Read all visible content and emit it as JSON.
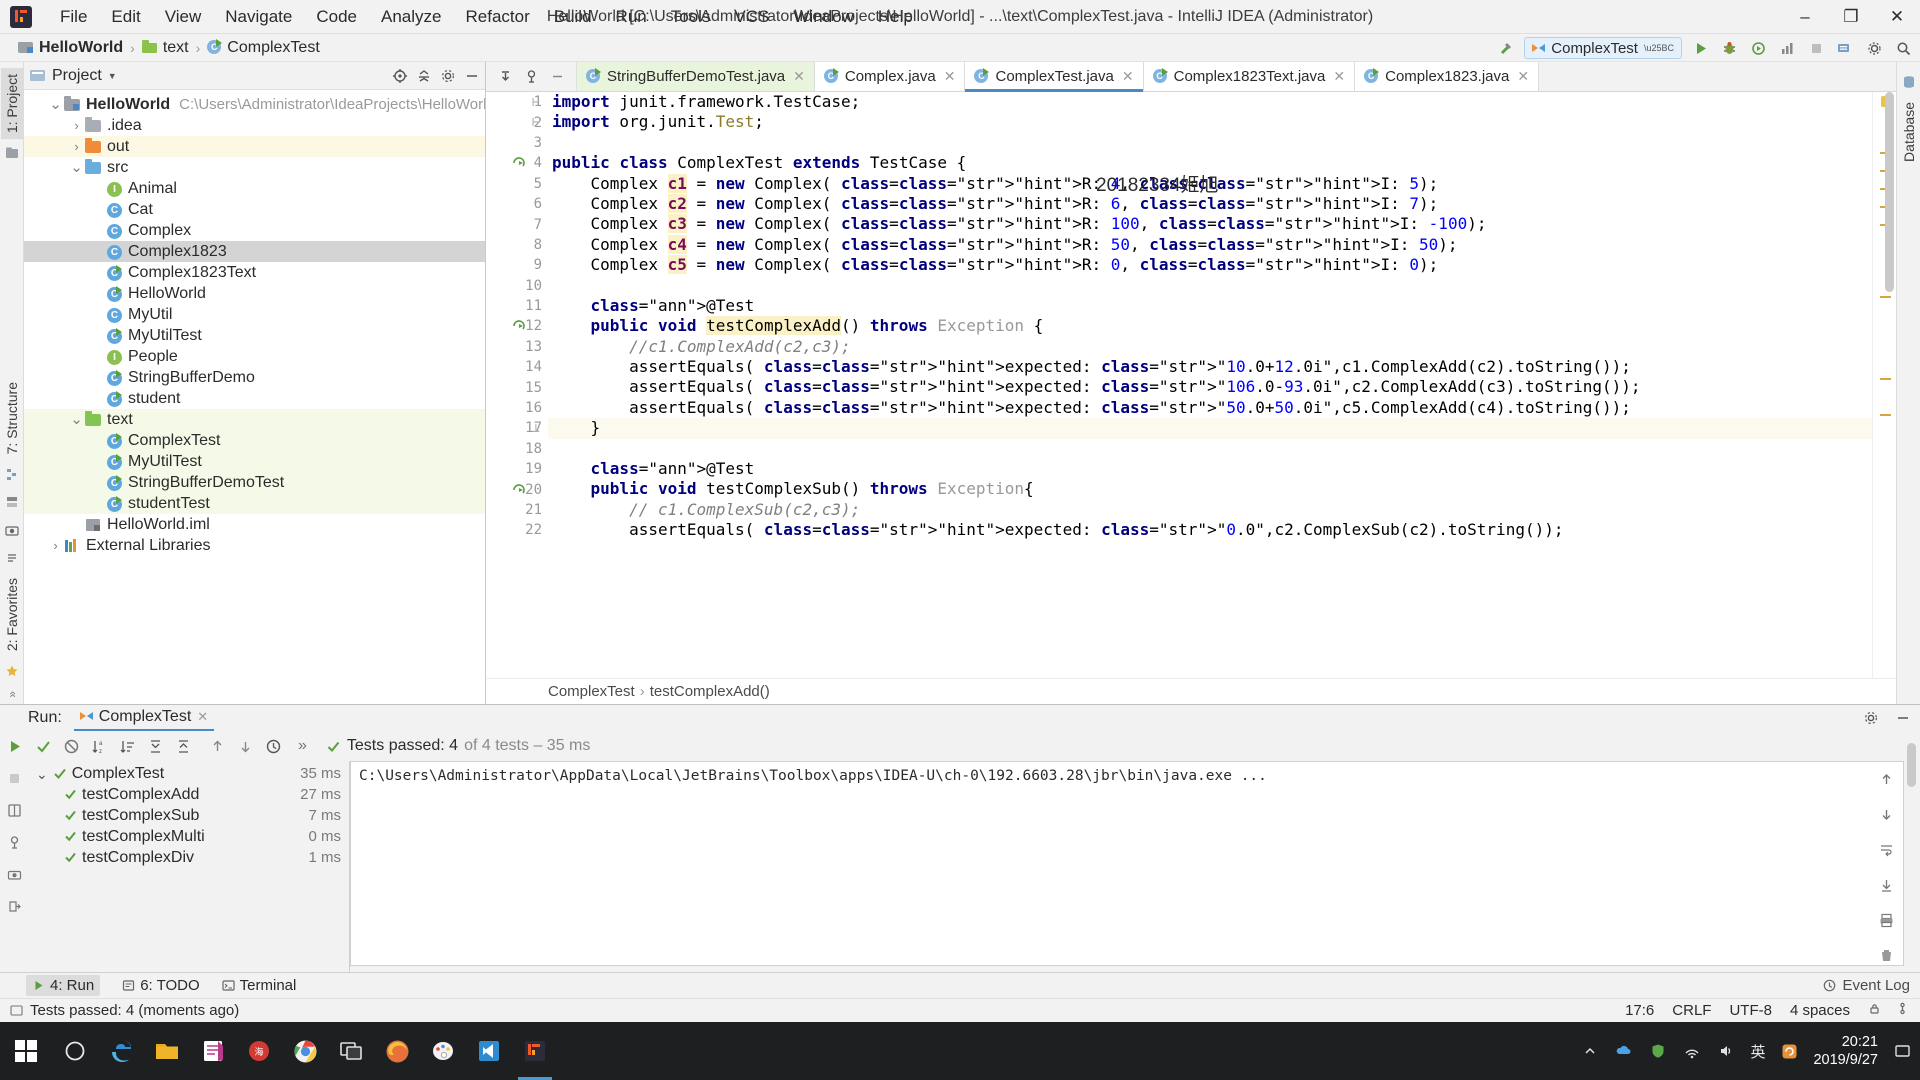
{
  "titlebar": {
    "window_title": "HelloWorld [C:\\Users\\Administrator\\IdeaProjects\\HelloWorld] - ...\\text\\ComplexTest.java - IntelliJ IDEA (Administrator)",
    "menus": [
      "File",
      "Edit",
      "View",
      "Navigate",
      "Code",
      "Analyze",
      "Refactor",
      "Build",
      "Run",
      "Tools",
      "VCS",
      "Window",
      "Help"
    ],
    "minimize": "–",
    "maximize": "❐",
    "close": "✕"
  },
  "navbar": {
    "breadcrumbs": [
      {
        "label": "HelloWorld",
        "icon": "project-module-icon"
      },
      {
        "label": "text",
        "icon": "folder-icon"
      },
      {
        "label": "ComplexTest",
        "icon": "java-class-icon"
      }
    ],
    "separator": "›",
    "run_config": "ComplexTest",
    "icons": [
      "build-hammer-icon",
      "run-icon",
      "debug-icon",
      "run-coverage-icon",
      "profiler-icon",
      "stop-icon",
      "update-icon",
      "settings-icon",
      "search-icon"
    ]
  },
  "left_strip": {
    "tabs": [
      "1: Project"
    ],
    "bottom_tabs": [
      "7: Structure",
      "2: Favorites"
    ]
  },
  "right_strip": {
    "tabs": [
      "Database"
    ]
  },
  "project_panel": {
    "title": "Project",
    "tree": [
      {
        "label": "HelloWorld",
        "path": "C:\\Users\\Administrator\\IdeaProjects\\HelloWorld",
        "indent": 0,
        "arrow": "expanded",
        "icon": "project-module-icon",
        "bold": true,
        "state": "normal"
      },
      {
        "label": ".idea",
        "indent": 1,
        "arrow": "collapsed",
        "icon": "folder-gray-icon",
        "state": "normal"
      },
      {
        "label": "out",
        "indent": 1,
        "arrow": "collapsed",
        "icon": "folder-orange-icon",
        "state": "highlight-yellow"
      },
      {
        "label": "src",
        "indent": 1,
        "arrow": "expanded",
        "icon": "folder-blue-icon",
        "state": "normal"
      },
      {
        "label": "Animal",
        "indent": 2,
        "arrow": "none",
        "icon": "interface-icon",
        "state": "normal"
      },
      {
        "label": "Cat",
        "indent": 2,
        "arrow": "none",
        "icon": "class-icon",
        "state": "normal"
      },
      {
        "label": "Complex",
        "indent": 2,
        "arrow": "none",
        "icon": "class-icon",
        "state": "normal"
      },
      {
        "label": "Complex1823",
        "indent": 2,
        "arrow": "none",
        "icon": "class-icon",
        "state": "selected"
      },
      {
        "label": "Complex1823Text",
        "indent": 2,
        "arrow": "none",
        "icon": "class-runnable-icon",
        "state": "normal"
      },
      {
        "label": "HelloWorld",
        "indent": 2,
        "arrow": "none",
        "icon": "class-runnable-icon",
        "state": "normal"
      },
      {
        "label": "MyUtil",
        "indent": 2,
        "arrow": "none",
        "icon": "class-icon",
        "state": "normal"
      },
      {
        "label": "MyUtilTest",
        "indent": 2,
        "arrow": "none",
        "icon": "class-runnable-icon",
        "state": "normal"
      },
      {
        "label": "People",
        "indent": 2,
        "arrow": "none",
        "icon": "interface-icon",
        "state": "normal"
      },
      {
        "label": "StringBufferDemo",
        "indent": 2,
        "arrow": "none",
        "icon": "class-runnable-icon",
        "state": "normal"
      },
      {
        "label": "student",
        "indent": 2,
        "arrow": "none",
        "icon": "class-runnable-icon",
        "state": "normal"
      },
      {
        "label": "text",
        "indent": 1,
        "arrow": "expanded",
        "icon": "folder-green-icon",
        "state": "highlight-green"
      },
      {
        "label": "ComplexTest",
        "indent": 2,
        "arrow": "none",
        "icon": "class-runnable-icon",
        "state": "highlight-green"
      },
      {
        "label": "MyUtilTest",
        "indent": 2,
        "arrow": "none",
        "icon": "class-runnable-icon",
        "state": "highlight-green"
      },
      {
        "label": "StringBufferDemoTest",
        "indent": 2,
        "arrow": "none",
        "icon": "class-runnable-icon",
        "state": "highlight-green"
      },
      {
        "label": "studentTest",
        "indent": 2,
        "arrow": "none",
        "icon": "class-runnable-icon",
        "state": "highlight-green"
      },
      {
        "label": "HelloWorld.iml",
        "indent": 1,
        "arrow": "none",
        "icon": "iml-file-icon",
        "state": "normal"
      },
      {
        "label": "External Libraries",
        "indent": 0,
        "arrow": "collapsed",
        "icon": "libraries-icon",
        "state": "normal"
      }
    ]
  },
  "editor": {
    "tabs": [
      {
        "label": "StringBufferDemoTest.java",
        "state": "greenish",
        "close": "✕"
      },
      {
        "label": "Complex.java",
        "state": "white",
        "close": "✕"
      },
      {
        "label": "ComplexTest.java",
        "state": "active",
        "close": "✕"
      },
      {
        "label": "Complex1823Text.java",
        "state": "white",
        "close": "✕"
      },
      {
        "label": "Complex1823.java",
        "state": "white",
        "close": "✕"
      }
    ],
    "watermark": "20182334姬旭",
    "breadcrumb": [
      "ComplexTest",
      "testComplexAdd()"
    ],
    "breadcrumb_sep": "›",
    "first_line_number": 1,
    "lines": [
      {
        "n": 1,
        "gutter_icon": "fold-icon",
        "text": "import junit.framework.TestCase;"
      },
      {
        "n": 2,
        "gutter_icon": "fold-icon",
        "text": "import org.junit.Test;"
      },
      {
        "n": 3,
        "gutter_icon": "",
        "text": ""
      },
      {
        "n": 4,
        "gutter_icon": "run-test-icon",
        "text": "public class ComplexTest extends TestCase {"
      },
      {
        "n": 5,
        "gutter_icon": "",
        "text": "    Complex c1 = new Complex( R: 4, I: 5);"
      },
      {
        "n": 6,
        "gutter_icon": "",
        "text": "    Complex c2 = new Complex( R: 6, I: 7);"
      },
      {
        "n": 7,
        "gutter_icon": "",
        "text": "    Complex c3 = new Complex( R: 100, I: -100);"
      },
      {
        "n": 8,
        "gutter_icon": "",
        "text": "    Complex c4 = new Complex( R: 50, I: 50);"
      },
      {
        "n": 9,
        "gutter_icon": "",
        "text": "    Complex c5 = new Complex( R: 0, I: 0);"
      },
      {
        "n": 10,
        "gutter_icon": "",
        "text": ""
      },
      {
        "n": 11,
        "gutter_icon": "",
        "text": "    @Test"
      },
      {
        "n": 12,
        "gutter_icon": "run-test-icon",
        "text": "    public void testComplexAdd() throws Exception {"
      },
      {
        "n": 13,
        "gutter_icon": "",
        "text": "        //c1.ComplexAdd(c2,c3);"
      },
      {
        "n": 14,
        "gutter_icon": "",
        "text": "        assertEquals( expected: \"10.0+12.0i\",c1.ComplexAdd(c2).toString());"
      },
      {
        "n": 15,
        "gutter_icon": "",
        "text": "        assertEquals( expected: \"106.0-93.0i\",c2.ComplexAdd(c3).toString());"
      },
      {
        "n": 16,
        "gutter_icon": "",
        "text": "        assertEquals( expected: \"50.0+50.0i\",c5.ComplexAdd(c4).toString());"
      },
      {
        "n": 17,
        "gutter_icon": "fold-end-icon",
        "text": "    }"
      },
      {
        "n": 18,
        "gutter_icon": "",
        "text": ""
      },
      {
        "n": 19,
        "gutter_icon": "",
        "text": "    @Test"
      },
      {
        "n": 20,
        "gutter_icon": "run-test-icon",
        "text": "    public void testComplexSub() throws Exception{"
      },
      {
        "n": 21,
        "gutter_icon": "",
        "text": "        // c1.ComplexSub(c2,c3);"
      },
      {
        "n": 22,
        "gutter_icon": "",
        "text": "        assertEquals( expected: \"0.0\",c2.ComplexSub(c2).toString());"
      }
    ]
  },
  "run_panel": {
    "label": "Run:",
    "tab_title": "ComplexTest",
    "tab_close": "✕",
    "status_text": "Tests passed: 4",
    "status_suffix": "of 4 tests – 35 ms",
    "chevrons": "»",
    "root": {
      "label": "ComplexTest",
      "duration": "35 ms"
    },
    "tests": [
      {
        "label": "testComplexAdd",
        "duration": "27 ms",
        "status": "passed"
      },
      {
        "label": "testComplexSub",
        "duration": "7 ms",
        "status": "passed"
      },
      {
        "label": "testComplexMulti",
        "duration": "0 ms",
        "status": "passed"
      },
      {
        "label": "testComplexDiv",
        "duration": "1 ms",
        "status": "passed"
      }
    ],
    "console_line": "C:\\Users\\Administrator\\AppData\\Local\\JetBrains\\Toolbox\\apps\\IDEA-U\\ch-0\\192.6603.28\\jbr\\bin\\java.exe ..."
  },
  "bottom_bar": {
    "items": [
      {
        "label": "4: Run",
        "icon": "run-icon",
        "active": true
      },
      {
        "label": "6: TODO",
        "icon": "todo-icon",
        "active": false
      },
      {
        "label": "Terminal",
        "icon": "terminal-icon",
        "active": false
      }
    ],
    "event_log": "Event Log"
  },
  "status_bar": {
    "message": "Tests passed: 4 (moments ago)",
    "caret": "17:6",
    "line_sep": "CRLF",
    "encoding": "UTF-8",
    "indent": "4 spaces",
    "lock_icon": "lock-icon",
    "branch_icon": "git-branch-icon"
  },
  "taskbar": {
    "start_icon": "windows-start-icon",
    "apps": [
      {
        "name": "cortana-search-icon"
      },
      {
        "name": "edge-browser-icon"
      },
      {
        "name": "file-explorer-icon"
      },
      {
        "name": "onenote-icon"
      },
      {
        "name": "netease-music-icon"
      },
      {
        "name": "chrome-icon"
      },
      {
        "name": "window-switcher-icon"
      },
      {
        "name": "firefox-icon"
      },
      {
        "name": "paint-icon"
      },
      {
        "name": "vscode-icon"
      },
      {
        "name": "intellij-idea-icon",
        "active": true
      }
    ],
    "tray": [
      "chevron-up-icon",
      "onedrive-icon",
      "shield-icon",
      "network-icon",
      "volume-icon"
    ],
    "ime": "英",
    "clock_time": "20:21",
    "clock_date": "2019/9/27",
    "notification_icon": "action-center-icon"
  },
  "colors": {
    "accent_blue": "#4a88c7",
    "green_pass": "#5a9e3f",
    "tab_green": "#e8f4dc",
    "selection_gray": "#d4d4d4",
    "string_green": "#008000",
    "keyword_blue": "#00007f"
  }
}
